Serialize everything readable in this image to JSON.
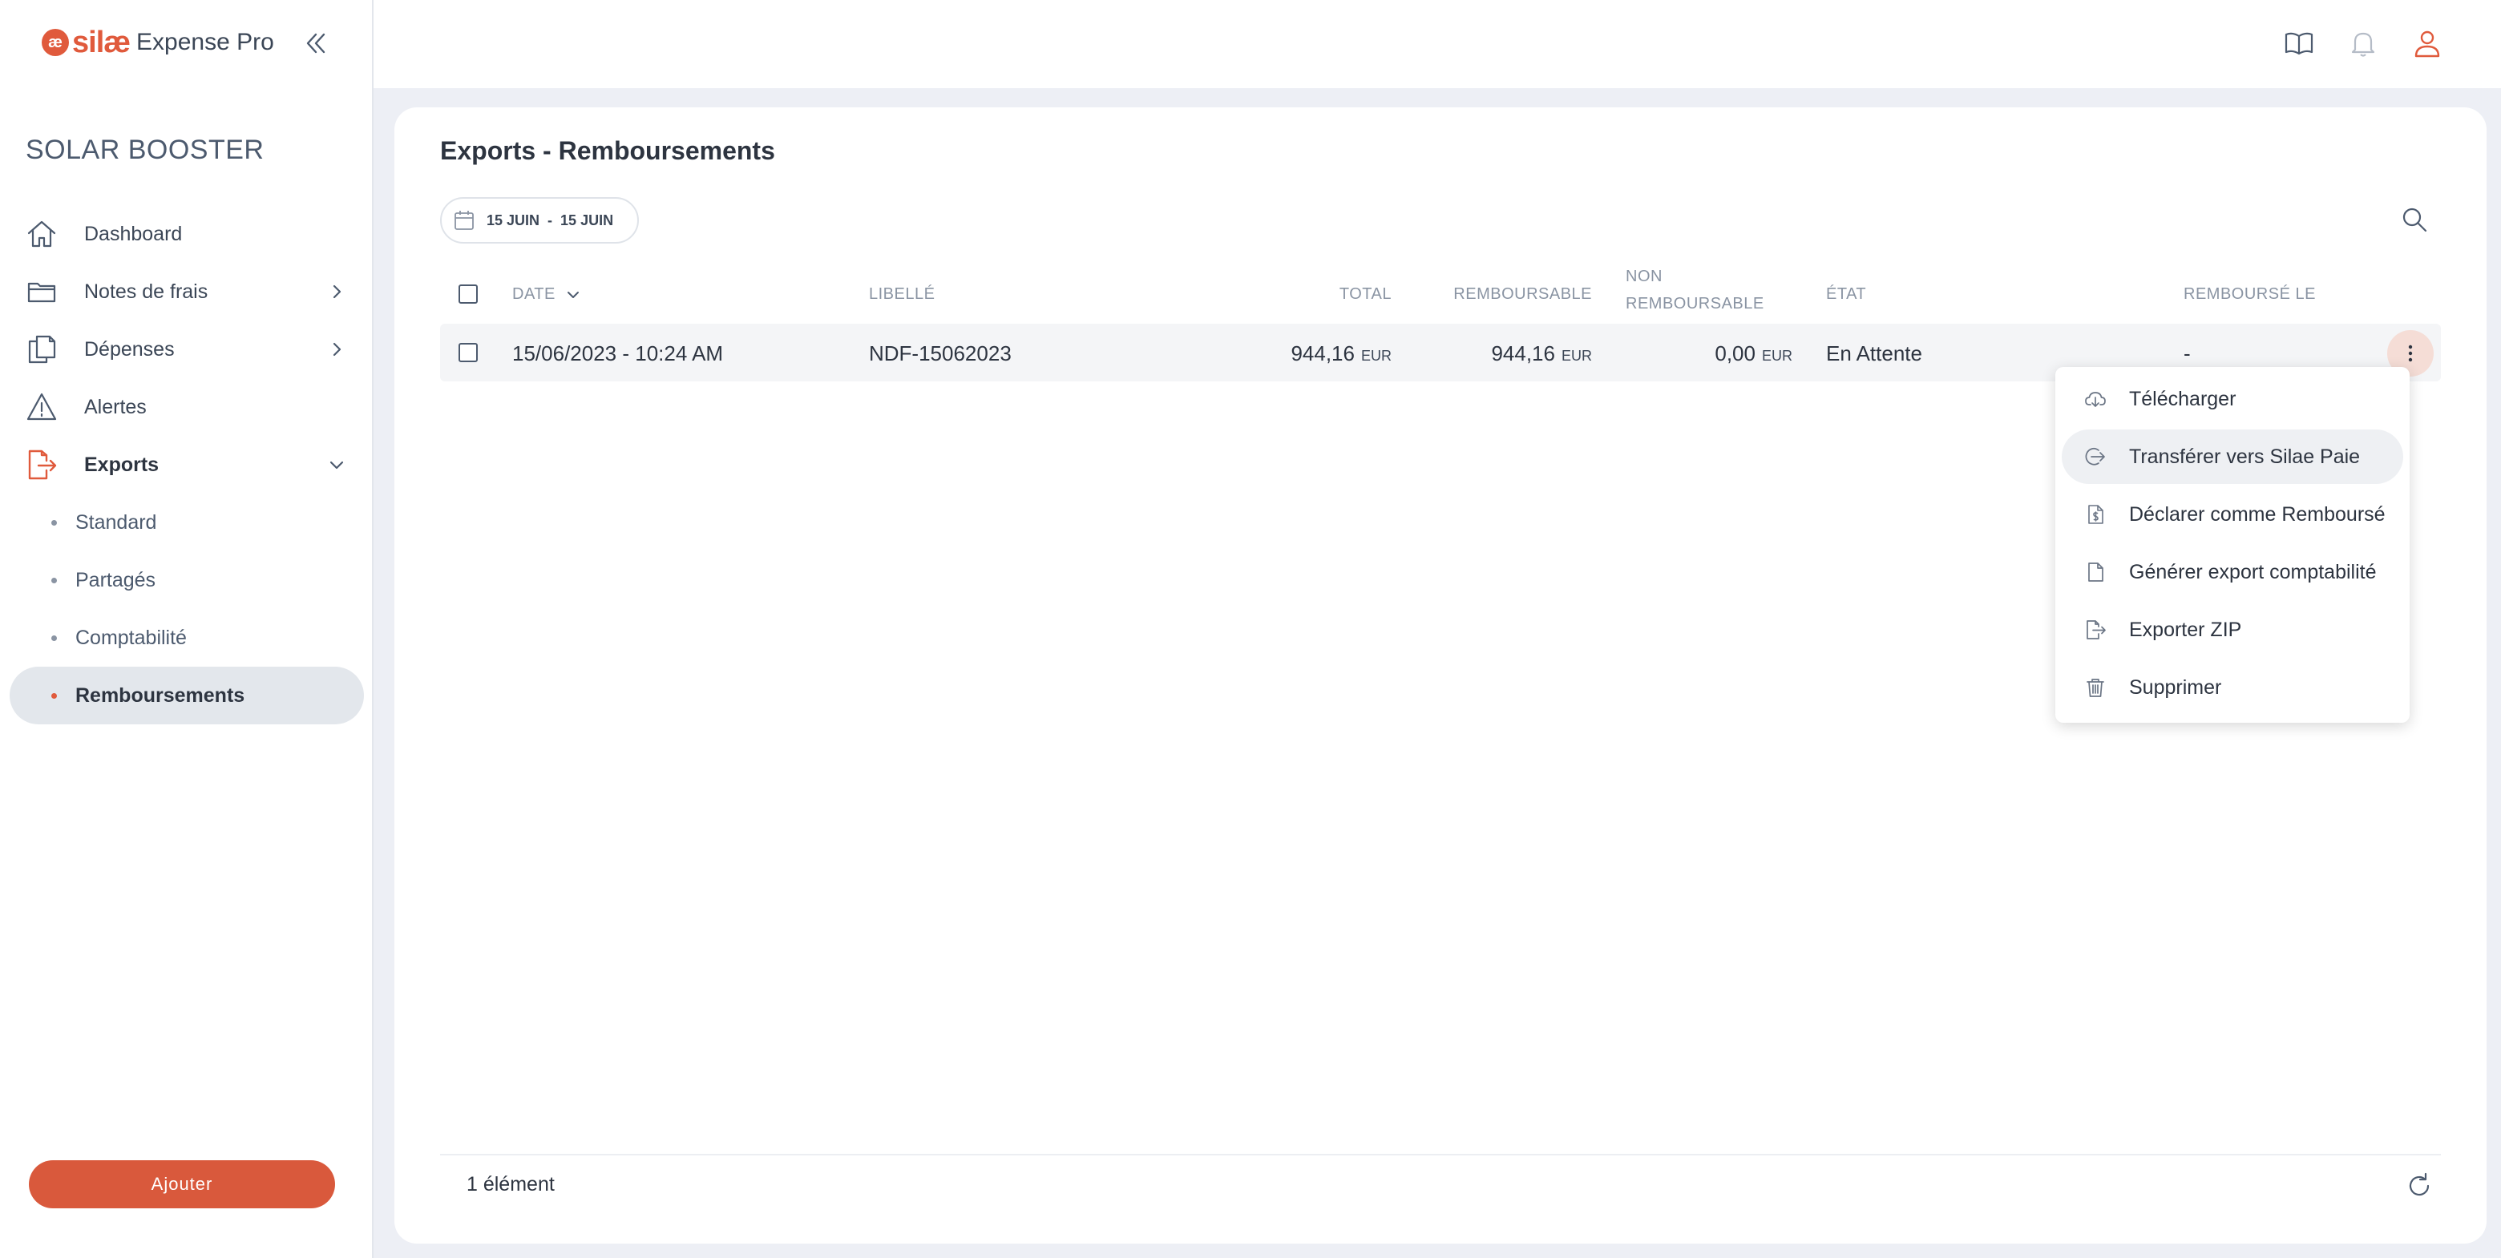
{
  "app": {
    "brand": "silæ",
    "product": "Expense Pro",
    "logo_glyph": "æ",
    "accent": "#e05a3c"
  },
  "sidebar": {
    "org": "SOLAR BOOSTER",
    "items": [
      {
        "label": "Dashboard",
        "icon": "home-icon"
      },
      {
        "label": "Notes de frais",
        "icon": "folder-icon"
      },
      {
        "label": "Dépenses",
        "icon": "copy-icon"
      },
      {
        "label": "Alertes",
        "icon": "warning-icon"
      },
      {
        "label": "Exports",
        "icon": "export-icon"
      }
    ],
    "sub_items": [
      {
        "label": "Standard"
      },
      {
        "label": "Partagés"
      },
      {
        "label": "Comptabilité"
      },
      {
        "label": "Remboursements"
      }
    ],
    "add_label": "Ajouter"
  },
  "main": {
    "title": "Exports - Remboursements",
    "date_from": "15 JUIN",
    "date_sep": "-",
    "date_to": "15 JUIN",
    "columns": {
      "date": "DATE",
      "libelle": "LIBELLÉ",
      "total": "TOTAL",
      "remboursable": "REMBOURSABLE",
      "non_line1": "NON",
      "non_line2": "REMBOURSABLE",
      "etat": "ÉTAT",
      "rembourse_le": "REMBOURSÉ LE"
    },
    "rows": [
      {
        "date": "15/06/2023 - 10:24 AM",
        "libelle": "NDF-15062023",
        "total": "944,16",
        "remboursable": "944,16",
        "non_remboursable": "0,00",
        "currency": "EUR",
        "etat": "En Attente",
        "rembourse_le": "-"
      }
    ],
    "count": "1 élément"
  },
  "menu": {
    "items": [
      {
        "label": "Télécharger",
        "icon": "cloud-download-icon"
      },
      {
        "label": "Transférer vers Silae Paie",
        "icon": "transfer-icon"
      },
      {
        "label": "Déclarer comme Remboursé",
        "icon": "receipt-icon"
      },
      {
        "label": "Générer export comptabilité",
        "icon": "file-icon"
      },
      {
        "label": "Exporter ZIP",
        "icon": "file-export-icon"
      },
      {
        "label": "Supprimer",
        "icon": "trash-icon"
      }
    ]
  }
}
